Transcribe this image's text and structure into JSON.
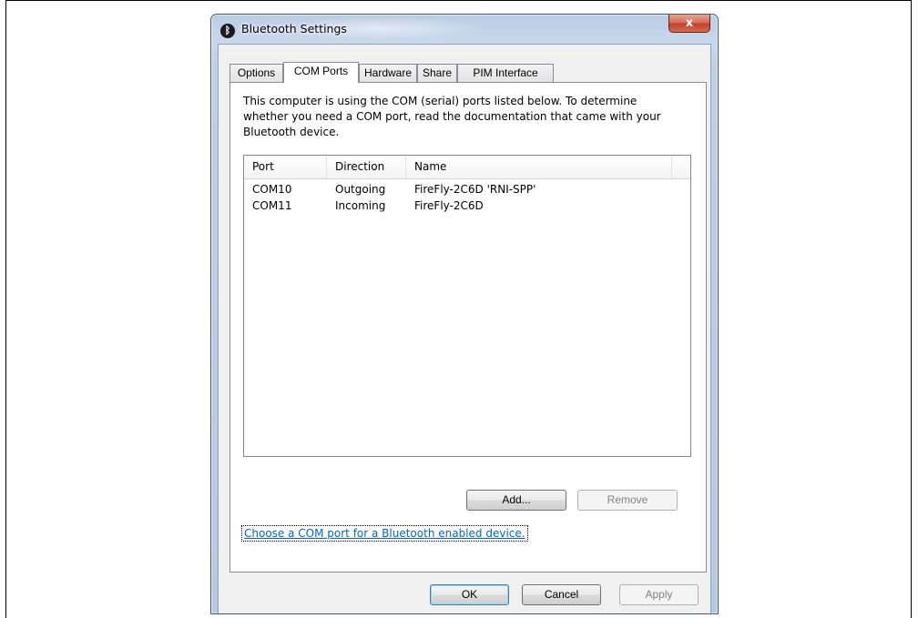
{
  "window": {
    "title": "Bluetooth Settings",
    "app_icon_glyph": "ᛒ",
    "close_glyph": "x"
  },
  "tabs": [
    {
      "label": "Options"
    },
    {
      "label": "COM Ports"
    },
    {
      "label": "Hardware"
    },
    {
      "label": "Share"
    },
    {
      "label": "PIM Interface"
    }
  ],
  "active_tab": "COM Ports",
  "com_ports": {
    "description": "This computer is using the COM (serial) ports listed below. To determine whether you need a COM port, read the documentation that came with your Bluetooth device.",
    "columns": [
      "Port",
      "Direction",
      "Name"
    ],
    "rows": [
      {
        "port": "COM10",
        "direction": "Outgoing",
        "name": "FireFly-2C6D 'RNI-SPP'"
      },
      {
        "port": "COM11",
        "direction": "Incoming",
        "name": "FireFly-2C6D"
      }
    ],
    "add_label": "Add...",
    "remove_label": "Remove",
    "link_text": "Choose a COM port for a Bluetooth enabled device."
  },
  "footer": {
    "ok_label": "OK",
    "cancel_label": "Cancel",
    "apply_label": "Apply"
  }
}
